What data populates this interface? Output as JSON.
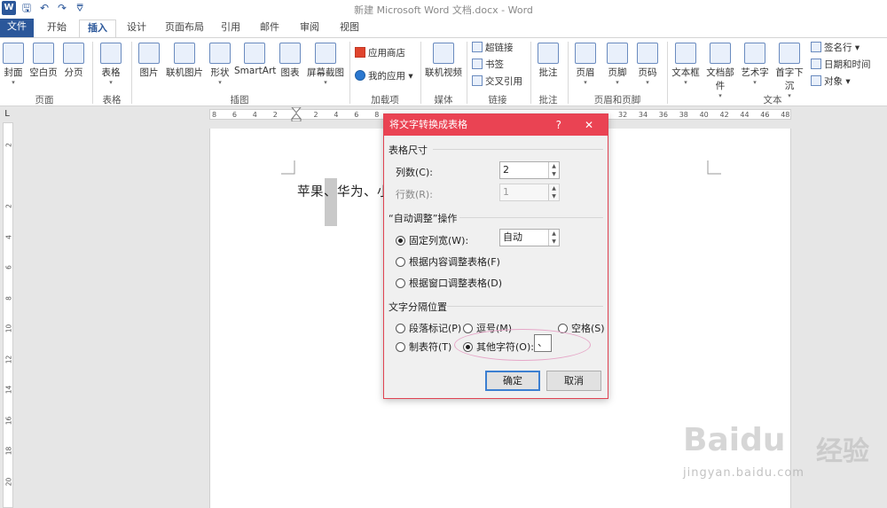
{
  "window": {
    "title": "新建 Microsoft Word 文档.docx - Word"
  },
  "qat": {
    "word_logo": "W",
    "save": "🖫",
    "undo": "↶",
    "redo": "↷",
    "customize": "⩢"
  },
  "tabs": [
    "文件",
    "开始",
    "插入",
    "设计",
    "页面布局",
    "引用",
    "邮件",
    "审阅",
    "视图"
  ],
  "ribbon": {
    "pages": {
      "cover": "封面",
      "blank": "空白页",
      "break": "分页",
      "group": "页面"
    },
    "tables": {
      "table": "表格",
      "group": "表格"
    },
    "illustrations": {
      "picture": "图片",
      "online_picture": "联机图片",
      "shapes": "形状",
      "smartart": "SmartArt",
      "chart": "图表",
      "screenshot": "屏幕截图",
      "group": "插图"
    },
    "addins": {
      "store": "应用商店",
      "my_apps": "我的应用",
      "group": "加载项"
    },
    "media": {
      "online_video": "联机视频",
      "group": "媒体"
    },
    "links": {
      "hyperlink": "超链接",
      "bookmark": "书签",
      "cross_ref": "交叉引用",
      "group": "链接"
    },
    "comments": {
      "comment": "批注",
      "group": "批注"
    },
    "header_footer": {
      "header": "页眉",
      "footer": "页脚",
      "page_number": "页码",
      "group": "页眉和页脚"
    },
    "text": {
      "textbox": "文本框",
      "quick_parts": "文档部件",
      "wordart": "艺术字",
      "dropcap": "首字下沉",
      "signature": "签名行",
      "datetime": "日期和时间",
      "object": "对象",
      "group": "文本"
    }
  },
  "ruler": {
    "h_ticks": [
      "8",
      "6",
      "4",
      "2",
      "",
      "2",
      "4",
      "6",
      "8",
      "",
      "",
      "",
      "",
      "",
      "",
      "",
      "",
      "",
      "",
      "",
      "32",
      "34",
      "36",
      "38",
      "40",
      "42",
      "44",
      "46",
      "48"
    ],
    "v_ticks": [
      "2",
      "",
      "2",
      "4",
      "6",
      "8",
      "10",
      "12",
      "14",
      "16",
      "18",
      "20"
    ]
  },
  "document": {
    "text": "苹果、华为、小"
  },
  "dialog": {
    "title": "将文字转换成表格",
    "help": "?",
    "close": "✕",
    "size_section": "表格尺寸",
    "cols_label": "列数(C):",
    "cols_value": "2",
    "rows_label": "行数(R):",
    "rows_value": "1",
    "autofit_section": "“自动调整”操作",
    "fixed_label": "固定列宽(W):",
    "fixed_value": "自动",
    "fit_content": "根据内容调整表格(F)",
    "fit_window": "根据窗口调整表格(D)",
    "sep_section": "文字分隔位置",
    "paragraph": "段落标记(P)",
    "comma": "逗号(M)",
    "space": "空格(S)",
    "tab": "制表符(T)",
    "other": "其他字符(O):",
    "other_value": "、",
    "ok": "确定",
    "cancel": "取消"
  },
  "watermark": {
    "brand": "Baidu",
    "cn": "经验",
    "url": "jingyan.baidu.com"
  },
  "colors": {
    "accent": "#2b579a",
    "dialog_title": "#ea4353",
    "highlight_ellipse": "#e6a6c7"
  }
}
